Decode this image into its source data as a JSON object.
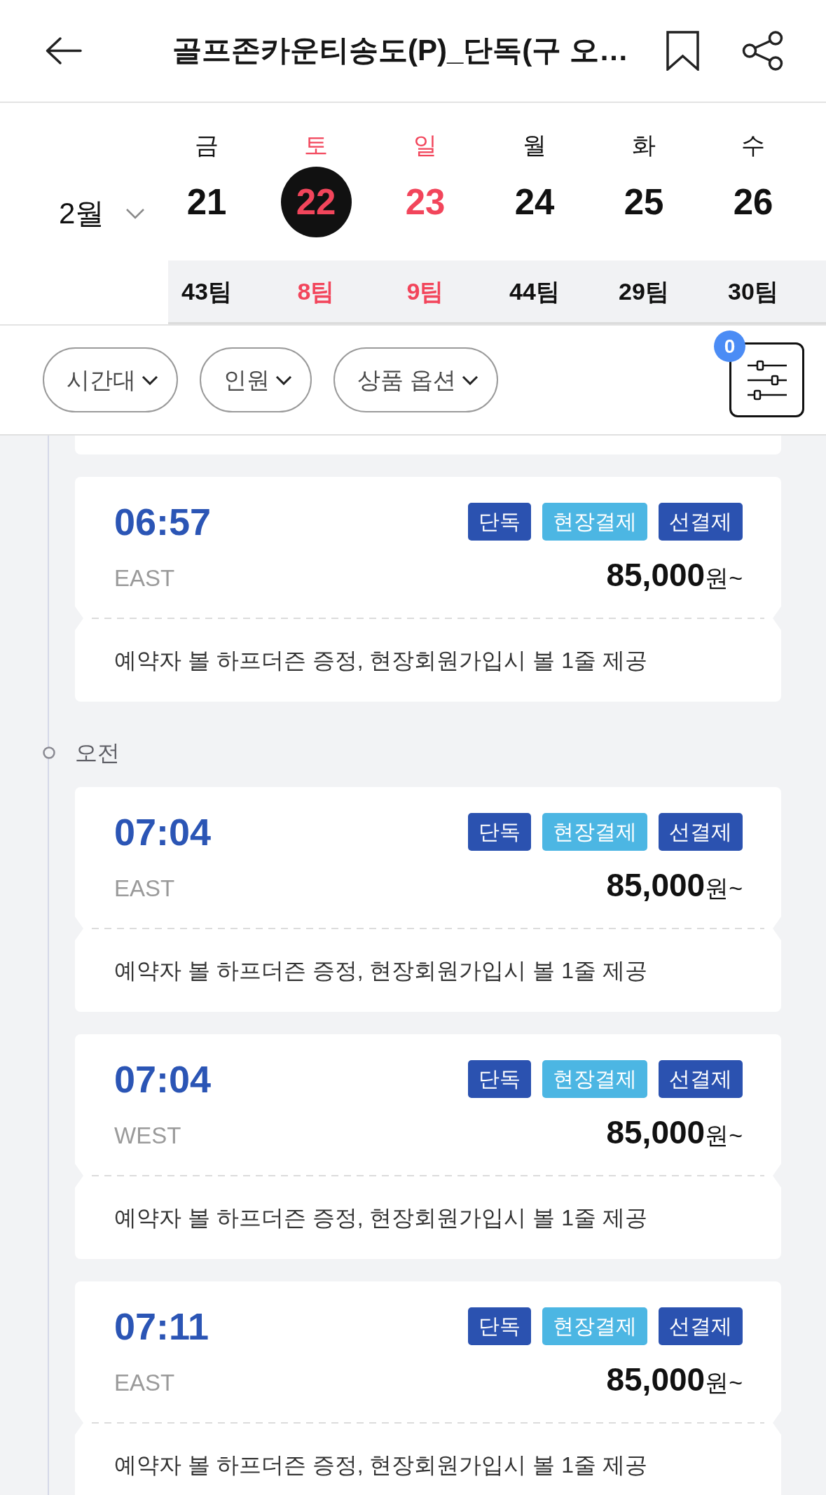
{
  "header": {
    "title": "골프존카운티송도(P)_단독(구 오…"
  },
  "calendar": {
    "month": "2월",
    "days": [
      {
        "weekday": "금",
        "date": "21",
        "teams": "43팀",
        "weekend": false,
        "selected": false
      },
      {
        "weekday": "토",
        "date": "22",
        "teams": "8팀",
        "weekend": true,
        "selected": true
      },
      {
        "weekday": "일",
        "date": "23",
        "teams": "9팀",
        "weekend": true,
        "selected": false
      },
      {
        "weekday": "월",
        "date": "24",
        "teams": "44팀",
        "weekend": false,
        "selected": false
      },
      {
        "weekday": "화",
        "date": "25",
        "teams": "29팀",
        "weekend": false,
        "selected": false
      },
      {
        "weekday": "수",
        "date": "26",
        "teams": "30팀",
        "weekend": false,
        "selected": false
      }
    ]
  },
  "filters": {
    "chips": [
      {
        "label": "시간대"
      },
      {
        "label": "인원"
      },
      {
        "label": "상품 옵션"
      }
    ],
    "active_count": "0"
  },
  "timeline": [
    {
      "kind": "card_edge"
    },
    {
      "kind": "slot",
      "time": "06:57",
      "course": "EAST",
      "tags": [
        {
          "label": "단독",
          "color": "#2b52b0"
        },
        {
          "label": "현장결제",
          "color": "#4cb6e3"
        },
        {
          "label": "선결제",
          "color": "#2b52b0"
        }
      ],
      "price": "85,000",
      "price_suffix": "원~",
      "note": "예약자 볼 하프더즌 증정, 현장회원가입시 볼 1줄 제공"
    },
    {
      "kind": "section",
      "label": "오전"
    },
    {
      "kind": "slot",
      "time": "07:04",
      "course": "EAST",
      "tags": [
        {
          "label": "단독",
          "color": "#2b52b0"
        },
        {
          "label": "현장결제",
          "color": "#4cb6e3"
        },
        {
          "label": "선결제",
          "color": "#2b52b0"
        }
      ],
      "price": "85,000",
      "price_suffix": "원~",
      "note": "예약자 볼 하프더즌 증정, 현장회원가입시 볼 1줄 제공"
    },
    {
      "kind": "slot",
      "time": "07:04",
      "course": "WEST",
      "tags": [
        {
          "label": "단독",
          "color": "#2b52b0"
        },
        {
          "label": "현장결제",
          "color": "#4cb6e3"
        },
        {
          "label": "선결제",
          "color": "#2b52b0"
        }
      ],
      "price": "85,000",
      "price_suffix": "원~",
      "note": "예약자 볼 하프더즌 증정, 현장회원가입시 볼 1줄 제공"
    },
    {
      "kind": "slot",
      "time": "07:11",
      "course": "EAST",
      "tags": [
        {
          "label": "단독",
          "color": "#2b52b0"
        },
        {
          "label": "현장결제",
          "color": "#4cb6e3"
        },
        {
          "label": "선결제",
          "color": "#2b52b0"
        }
      ],
      "price": "85,000",
      "price_suffix": "원~",
      "note": "예약자 볼 하프더즌 증정, 현장회원가입시 볼 1줄 제공"
    }
  ]
}
